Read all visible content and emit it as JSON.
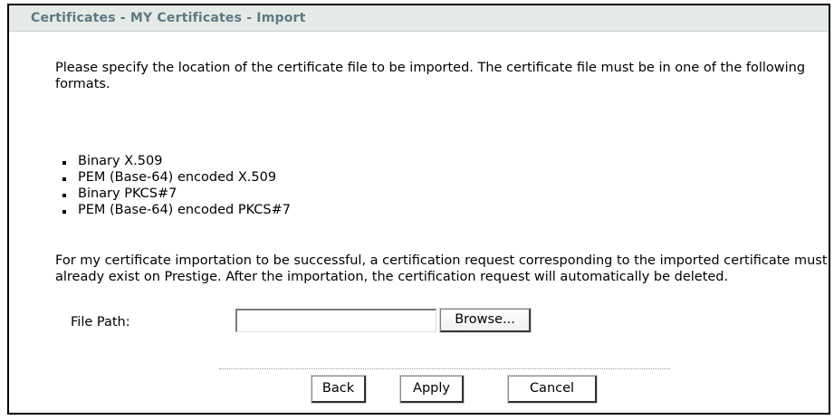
{
  "title": "Certificates - MY Certificates - Import",
  "intro": "Please specify the location of the certificate file to be imported. The certificate file must be in one of the following formats.",
  "formats": [
    "Binary X.509",
    "PEM (Base-64) encoded X.509",
    "Binary PKCS#7",
    "PEM (Base-64) encoded PKCS#7"
  ],
  "note": "For my certificate importation to be successful, a certification request corresponding to the imported certificate must already exist on Prestige. After the importation, the certification request will automatically be deleted.",
  "file_path": {
    "label": "File Path:",
    "value": "",
    "browse_label": "Browse..."
  },
  "actions": {
    "back_label": "Back",
    "apply_label": "Apply",
    "cancel_label": "Cancel"
  },
  "colors": {
    "title_bg": "#e5eae6",
    "title_text": "#5c7a85",
    "frame_border": "#000000"
  }
}
